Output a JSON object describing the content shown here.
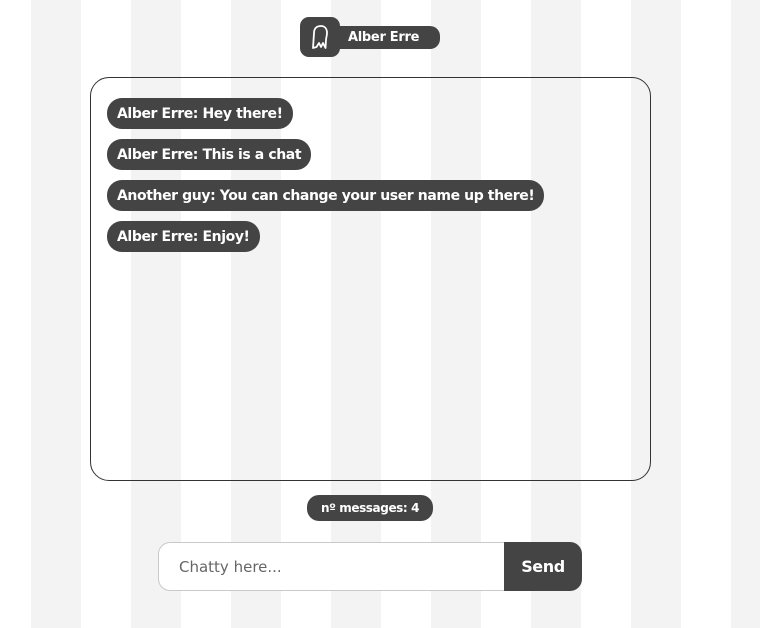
{
  "header": {
    "user_icon": "ghost-icon",
    "user_name": "Alber Erre"
  },
  "chat": {
    "messages": [
      {
        "text": "Alber Erre: Hey there!"
      },
      {
        "text": "Alber Erre: This is a chat"
      },
      {
        "text": "Another guy: You can change your user name up there!"
      },
      {
        "text": "Alber Erre: Enjoy!"
      }
    ]
  },
  "counter": {
    "label": "nº messages: 4"
  },
  "composer": {
    "placeholder": "Chatty here...",
    "value": "",
    "send_label": "Send"
  },
  "colors": {
    "pill": "#444444",
    "pill_text": "#ffffff",
    "stripe": "#f3f3f3",
    "background": "#ffffff",
    "border": "#333333"
  }
}
